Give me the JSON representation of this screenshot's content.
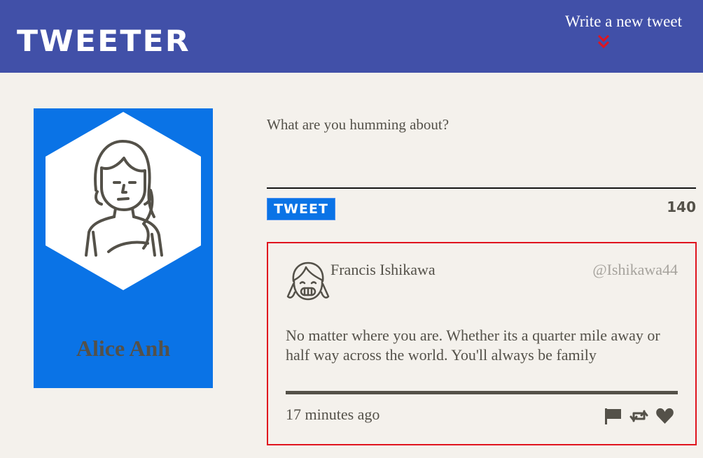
{
  "header": {
    "brand": "TWEETER",
    "compose_toggle_label": "Write a new tweet",
    "colors": {
      "bar": "#4150a8",
      "chevron": "#e0141e"
    }
  },
  "profile": {
    "name": "Alice Anh",
    "avatar_icon": "girl-long-hair-avatar-icon",
    "colors": {
      "card": "#0a73e6"
    }
  },
  "composer": {
    "placeholder": "What are you humming about?",
    "value": "",
    "submit_label": "TWEET",
    "char_counter": "140"
  },
  "tweets": [
    {
      "author": "Francis Ishikawa",
      "handle": "@Ishikawa44",
      "avatar_icon": "smiling-girl-avatar-icon",
      "text": "No matter where you are. Whether its a quarter mile away or half way across the world. You'll always be family",
      "timestamp": "17 minutes ago",
      "actions": [
        "flag-icon",
        "retweet-icon",
        "heart-icon"
      ],
      "colors": {
        "border": "#e0141e"
      }
    }
  ]
}
